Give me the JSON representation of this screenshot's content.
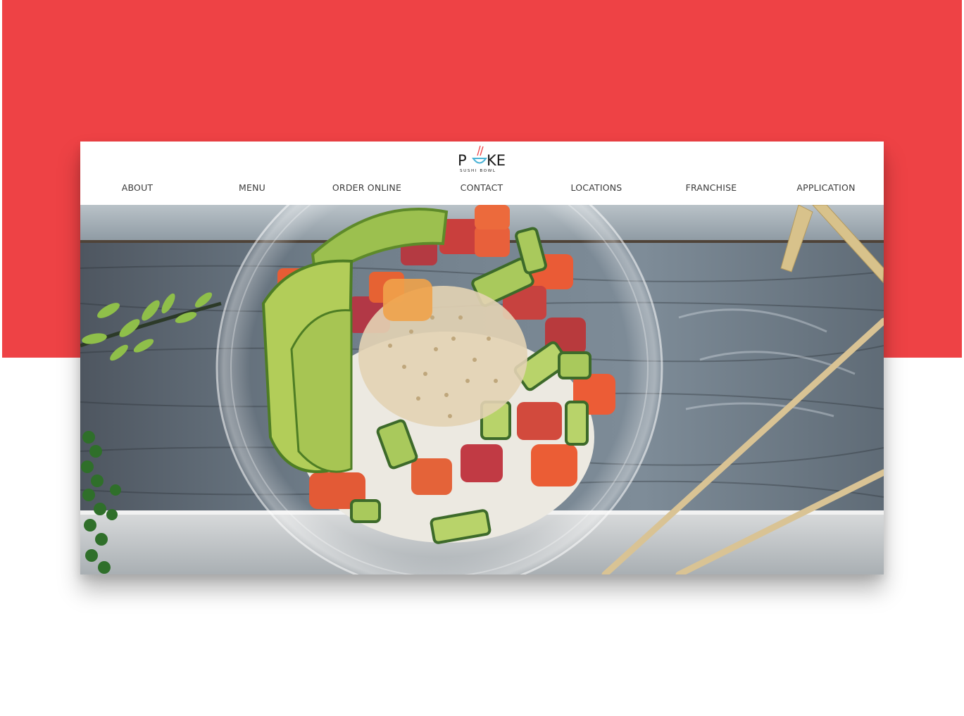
{
  "brand": {
    "logo_text": "POKE",
    "logo_subtext": "SUSHI BOWL"
  },
  "nav": {
    "items": [
      {
        "label": "ABOUT"
      },
      {
        "label": "MENU"
      },
      {
        "label": "ORDER ONLINE"
      },
      {
        "label": "CONTACT"
      },
      {
        "label": "LOCATIONS"
      },
      {
        "label": "FRANCHISE"
      },
      {
        "label": "APPLICATION"
      }
    ]
  },
  "hero": {
    "image": "poke-bowl-photo",
    "scroll_icon": "chevron-down-icon"
  },
  "colors": {
    "accent": "#ee4245",
    "nav_text": "#3a3a3a",
    "background": "#ffffff"
  }
}
